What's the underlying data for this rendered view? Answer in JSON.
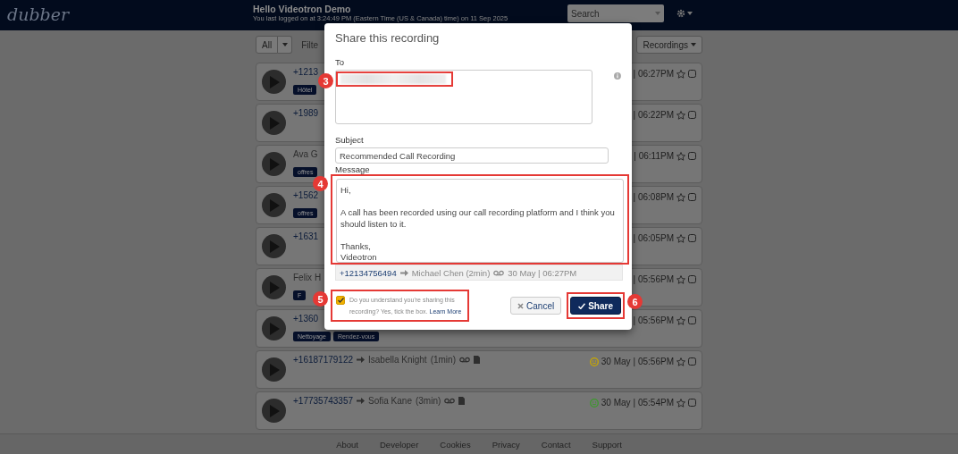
{
  "header": {
    "logo": "dubber",
    "greeting": "Hello Videotron Demo",
    "last_login": "You last logged on at 3:24:49 PM (Eastern Time (US & Canada) time) on 11 Sep 2025",
    "search": {
      "placeholder": "Search"
    }
  },
  "filter_bar": {
    "all_button": "All",
    "filter_text": "Filte",
    "recordings_button": "Recordings"
  },
  "recordings": [
    {
      "kind": "number",
      "caller": "+1213",
      "tags": [
        "Hôtel"
      ],
      "time": "| 06:27PM"
    },
    {
      "kind": "number",
      "caller": "+1989",
      "time": "| 06:22PM"
    },
    {
      "kind": "contact",
      "caller": "Ava G",
      "tags": [
        "offres"
      ],
      "time": "| 06:11PM"
    },
    {
      "kind": "number",
      "caller": "+1562",
      "tags": [
        "offres"
      ],
      "time": "| 06:08PM"
    },
    {
      "kind": "number",
      "caller": "+1631",
      "time": "| 06:05PM"
    },
    {
      "kind": "contact",
      "caller": "Felix H",
      "tags": [
        "F"
      ],
      "time": "| 05:56PM"
    },
    {
      "kind": "number",
      "caller": "+1360",
      "tags": [
        "Nettoyage",
        "Rendez-vous"
      ],
      "time": "| 05:56PM"
    },
    {
      "kind": "number",
      "caller": "+16187179122",
      "contact": "Isabella Knight",
      "duration": "(1min)",
      "color": "#c9a800",
      "date": "30 May",
      "time": "| 05:56PM"
    },
    {
      "kind": "number",
      "caller": "+17735743357",
      "contact": "Sofia Kane",
      "duration": "(3min)",
      "color": "#3c9a2c",
      "date": "30 May",
      "time": "| 05:54PM"
    }
  ],
  "footer_links": [
    "About",
    "Developer",
    "Cookies",
    "Privacy",
    "Contact",
    "Support"
  ],
  "dialog": {
    "title": "Share this recording",
    "to_label": "To",
    "subject_label": "Subject",
    "subject_value": "Recommended Call Recording",
    "message_label": "Message",
    "message_value": "Hi,\n\nA call has been recorded using our call recording platform and I think you should listen to it.\n\nThanks,\nVideotron",
    "recording": {
      "caller": "+12134756494",
      "contact": "Michael Chen (2min)",
      "date_time": "30 May | 06:27PM"
    },
    "consent": {
      "checked": true,
      "text": "Do you understand you're sharing this recording? Yes, tick the box.",
      "link": "Learn More"
    },
    "cancel_button": "Cancel",
    "share_button": "Share"
  },
  "annotations": [
    {
      "number": "3"
    },
    {
      "number": "4"
    },
    {
      "number": "5"
    },
    {
      "number": "6"
    }
  ]
}
